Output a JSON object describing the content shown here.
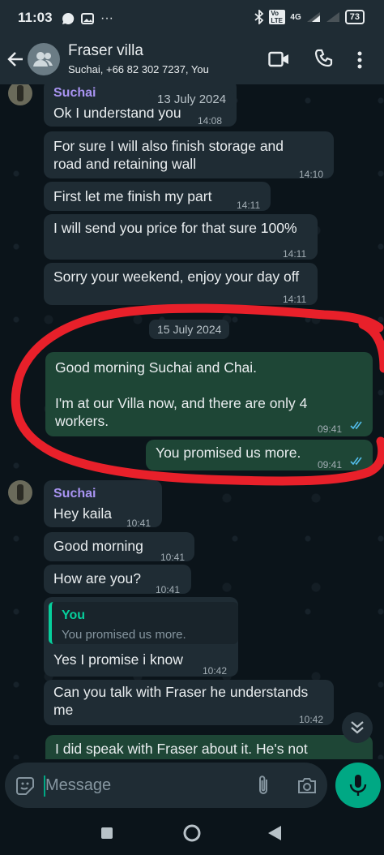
{
  "status_bar": {
    "time": "11:03",
    "network": "4G",
    "volte": "Vo LTE",
    "battery": "73"
  },
  "header": {
    "title": "Fraser villa",
    "subtitle": "Suchai, +66 82 302 7237, You"
  },
  "messages_block1": {
    "sender": "Suchai",
    "date_chip": "13 July 2024",
    "m1_text": "Ok I understand you",
    "m1_time": "14:08",
    "m2_line1": "For sure I will also finish storage and",
    "m2_line2": "road and retaining wall",
    "m2_time": "14:10",
    "m3_text": "First let me finish my part",
    "m3_time": "14:11",
    "m4_text": "I will send you price for that sure 100%",
    "m4_time": "14:11",
    "m5_text": "Sorry your weekend, enjoy your day off",
    "m5_time": "14:11"
  },
  "date_chip2": "15 July 2024",
  "outgoing": {
    "o1_line1": "Good morning Suchai and Chai.",
    "o1_line2": "I'm at our Villa now, and there are only 4",
    "o1_line3": "workers.",
    "o1_time": "09:41",
    "o2_text": "You promised us more.",
    "o2_time": "09:41"
  },
  "messages_block2": {
    "sender": "Suchai",
    "m1_text": "Hey kaila",
    "m1_time": "10:41",
    "m2_text": "Good morning",
    "m2_time": "10:41",
    "m3_text": "How are you?",
    "m3_time": "10:41",
    "reply_name": "You",
    "reply_quote": "You promised us more.",
    "m4_text": "Yes I promise i know",
    "m4_time": "10:42",
    "m5_line1": "Can you talk with Fraser he understands",
    "m5_line2": "me",
    "m5_time": "10:42"
  },
  "partial_outgoing": "I did speak with Fraser about it. He's not",
  "input": {
    "placeholder": "Message"
  },
  "colors": {
    "incoming_bubble": "#1f2c34",
    "outgoing_bubble": "#1e4636",
    "accent": "#00a884",
    "sender_name": "#a994f2",
    "annotation": "#e8202a"
  }
}
